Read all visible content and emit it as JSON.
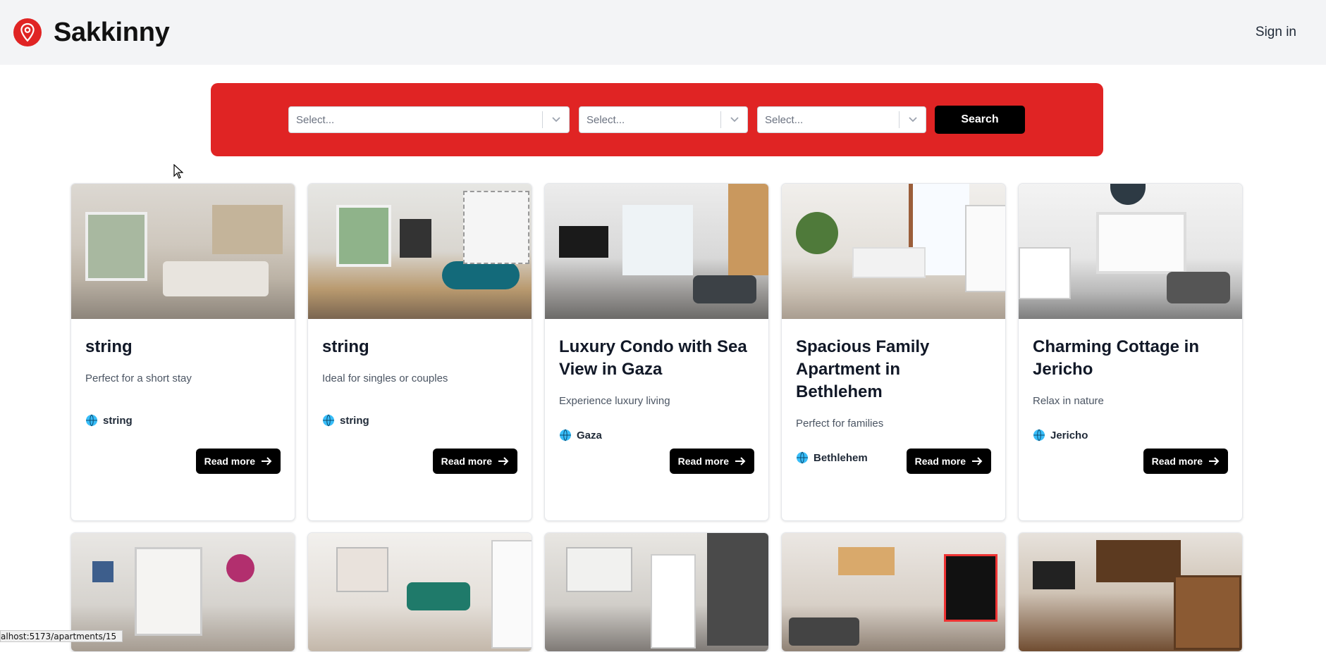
{
  "header": {
    "brand": "Sakkinny",
    "sign_in": "Sign in"
  },
  "search": {
    "selects": [
      {
        "placeholder": "Select..."
      },
      {
        "placeholder": "Select..."
      },
      {
        "placeholder": "Select..."
      }
    ],
    "button": "Search"
  },
  "cards_row1": [
    {
      "title": "string",
      "description": "Perfect for a short stay",
      "location": "string",
      "cta": "Read more"
    },
    {
      "title": "string",
      "description": "Ideal for singles or couples",
      "location": "string",
      "cta": "Read more"
    },
    {
      "title": "Luxury Condo with Sea View in Gaza",
      "description": "Experience luxury living",
      "location": "Gaza",
      "cta": "Read more"
    },
    {
      "title": "Spacious Family Apartment in Bethlehem",
      "description": "Perfect for families",
      "location": "Bethlehem",
      "cta": "Read more"
    },
    {
      "title": "Charming Cottage in Jericho",
      "description": "Relax in nature",
      "location": "Jericho",
      "cta": "Read more"
    }
  ],
  "status_bar": "alhost:5173/apartments/15",
  "colors": {
    "accent": "#e02424",
    "header_bg": "#f3f4f6",
    "button": "#000000"
  }
}
